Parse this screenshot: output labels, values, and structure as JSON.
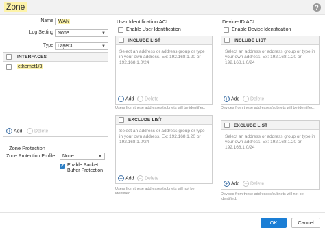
{
  "dialog": {
    "title": "Zone",
    "help": "?"
  },
  "fields": {
    "name_label": "Name",
    "name_value": "WAN",
    "log_label": "Log Setting",
    "log_value": "None",
    "type_label": "Type",
    "type_value": "Layer3"
  },
  "interfaces": {
    "header": "INTERFACES",
    "rows": [
      "ethernet1/3"
    ],
    "add": "Add",
    "delete": "Delete"
  },
  "zone_protection": {
    "title": "Zone Protection",
    "profile_label": "Zone Protection Profile",
    "profile_value": "None",
    "packet_buffer_label": "Enable Packet Buffer Protection",
    "packet_buffer_checked": true
  },
  "user_acl": {
    "title": "User Identification ACL",
    "enable_label": "Enable User Identification",
    "include_header": "INCLUDE LIST",
    "include_placeholder": "Select an address or address group or type in your own address. Ex: 192.168.1.20 or 192.168.1.0/24",
    "include_note": "Users from these addresses/subnets will be identified.",
    "exclude_header": "EXCLUDE LIST",
    "exclude_placeholder": "Select an address or address group or type in your own address. Ex: 192.168.1.20 or 192.168.1.0/24",
    "exclude_note": "Users from these addresses/subnets will not be identified.",
    "add": "Add",
    "delete": "Delete"
  },
  "device_acl": {
    "title": "Device-ID ACL",
    "enable_label": "Enable Device Identification",
    "include_header": "INCLUDE LIST",
    "include_placeholder": "Select an address or address group or type in your own address. Ex: 192.168.1.20 or 192.168.1.0/24",
    "include_note": "Devices from these addresses/subnets will be identified.",
    "exclude_header": "EXCLUDE LIST",
    "exclude_placeholder": "Select an address or address group or type in your own address. Ex: 192.168.1.20 or 192.168.1.0/24",
    "exclude_note": "Devices from these addresses/subnets will not be identified.",
    "add": "Add",
    "delete": "Delete"
  },
  "footer": {
    "ok": "OK",
    "cancel": "Cancel"
  },
  "colors": {
    "accent": "#1b7ed5",
    "highlight": "#fdf3a8"
  }
}
